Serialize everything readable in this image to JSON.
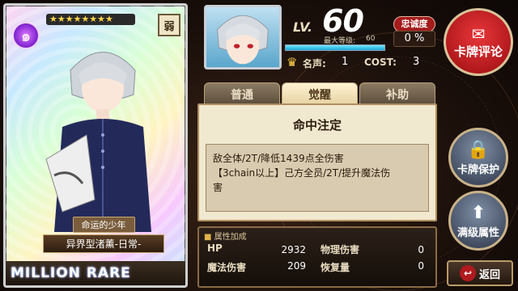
{
  "card": {
    "stars": "★★★★★★★★",
    "attribute_badge": "弱",
    "subtitle": "命运的少年",
    "name": "异界型渚薰-日常-",
    "rarity": "MILLION RARE"
  },
  "header": {
    "lv_label": "LV.",
    "level": "60",
    "max_level_label": "最大等级:",
    "max_level": "60",
    "exp_fraction": 1.0,
    "loyalty_label": "忠诚度",
    "loyalty_value": "0 %",
    "fame_label": "名声:",
    "fame_value": "1",
    "cost_label": "COST:",
    "cost_value": "3"
  },
  "buttons": {
    "review": "卡牌评论",
    "protect": "卡牌保护",
    "max_attr": "满级属性",
    "back": "返回"
  },
  "tabs": [
    {
      "label": "普通",
      "active": false
    },
    {
      "label": "觉醒",
      "active": true
    },
    {
      "label": "补助",
      "active": false
    }
  ],
  "skill": {
    "name": "命中注定",
    "desc_line1": "敌全体/2T/降低1439点全伤害",
    "desc_line2": "【3chain以上】己方全员/2T/提升魔法伤",
    "desc_line3": "害"
  },
  "stats": {
    "title": "属性加成",
    "hp_label": "HP",
    "hp_value": "2932",
    "phys_label": "物理伤害",
    "phys_value": "0",
    "magic_label": "魔法伤害",
    "magic_value": "209",
    "recover_label": "恢复量",
    "recover_value": "0"
  }
}
